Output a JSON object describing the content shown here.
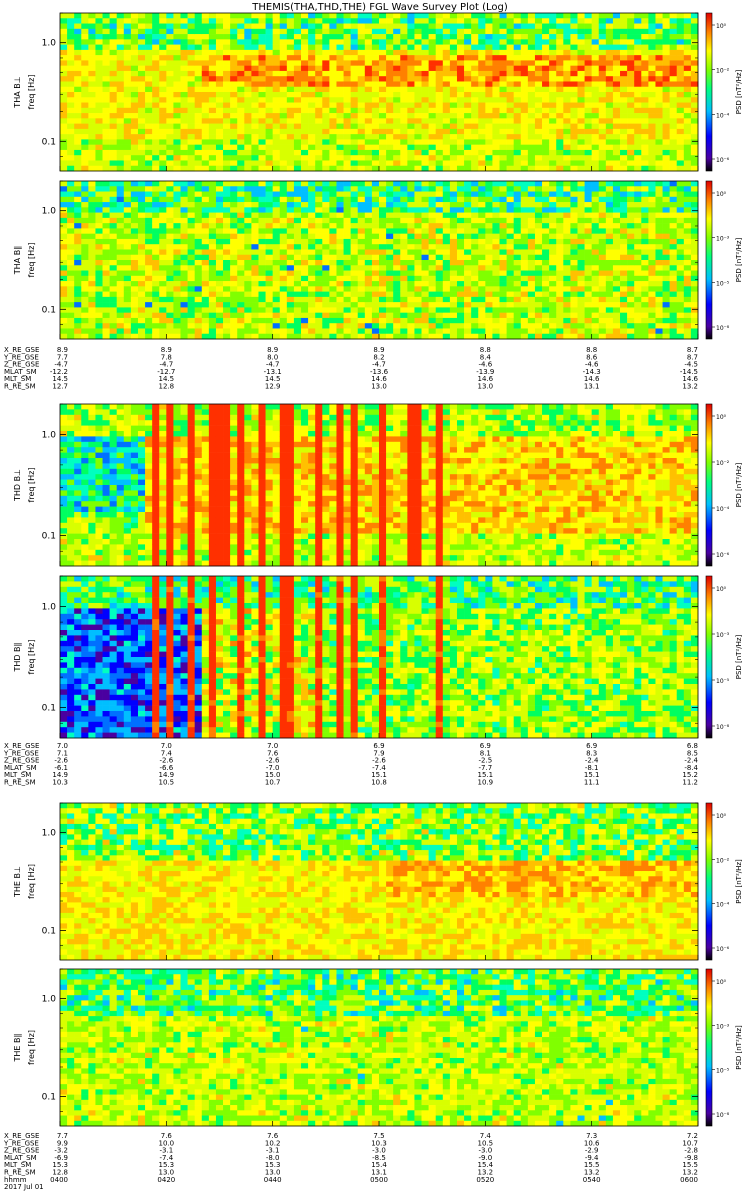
{
  "title": "THEMIS(THA,THD,THE) FGL Wave Survey Plot (Log)",
  "colorbar_label": "PSD [nT²/Hz]",
  "colorbar_ticks_top": [
    "10⁰",
    "10⁻²",
    "10⁻⁴",
    "10⁻⁶"
  ],
  "colorbar_ticks_bottom": [
    "10⁰",
    "10⁻³",
    "10⁻⁵",
    "10⁻⁸"
  ],
  "freq_ticks": [
    "1.0",
    "0.1"
  ],
  "chart_data": [
    {
      "type": "heatmap",
      "probe": "THA",
      "panels": [
        {
          "ylabel": "THA B⊥",
          "ylabel2": "freq [Hz]",
          "ylim": [
            0.05,
            2.0
          ],
          "scale": "log",
          "dominant_level": "yellow-orange, enhanced 0.2–0.4 Hz"
        },
        {
          "ylabel": "THA B∥",
          "ylabel2": "freq [Hz]",
          "ylim": [
            0.05,
            2.0
          ],
          "scale": "log",
          "dominant_level": "green-yellow"
        }
      ],
      "ephemeris": {
        "labels": [
          "X_RE_GSE",
          "Y_RE_GSE",
          "Z_RE_GSE",
          "MLAT_SM",
          "MLT_SM",
          "R_RE_SM"
        ],
        "columns": [
          [
            "8.9",
            "7.7",
            "-4.7",
            "-12.2",
            "14.5",
            "12.7"
          ],
          [
            "8.9",
            "7.8",
            "-4.7",
            "-12.7",
            "14.5",
            "12.8"
          ],
          [
            "8.9",
            "8.0",
            "-4.7",
            "-13.1",
            "14.5",
            "12.9"
          ],
          [
            "8.9",
            "8.2",
            "-4.7",
            "-13.6",
            "14.6",
            "13.0"
          ],
          [
            "8.8",
            "8.4",
            "-4.6",
            "-13.9",
            "14.6",
            "13.0"
          ],
          [
            "8.8",
            "8.6",
            "-4.6",
            "-14.3",
            "14.6",
            "13.1"
          ],
          [
            "8.7",
            "8.7",
            "-4.5",
            "-14.5",
            "14.6",
            "13.2"
          ]
        ]
      }
    },
    {
      "type": "heatmap",
      "probe": "THD",
      "panels": [
        {
          "ylabel": "THD B⊥",
          "ylabel2": "freq [Hz]",
          "ylim": [
            0.05,
            2.0
          ],
          "scale": "log",
          "dominant_level": "cyan early, red-orange bursts, yellow-orange later"
        },
        {
          "ylabel": "THD B∥",
          "ylabel2": "freq [Hz]",
          "ylim": [
            0.05,
            2.0
          ],
          "scale": "log",
          "dominant_level": "blue early, red bursts, green later"
        }
      ],
      "ephemeris": {
        "labels": [
          "X_RE_GSE",
          "Y_RE_GSE",
          "Z_RE_GSE",
          "MLAT_SM",
          "MLT_SM",
          "R_RE_SM"
        ],
        "columns": [
          [
            "7.0",
            "7.1",
            "-2.6",
            "-6.1",
            "14.9",
            "10.3"
          ],
          [
            "7.0",
            "7.4",
            "-2.6",
            "-6.6",
            "14.9",
            "10.5"
          ],
          [
            "7.0",
            "7.6",
            "-2.6",
            "-7.0",
            "15.0",
            "10.7"
          ],
          [
            "6.9",
            "7.9",
            "-2.6",
            "-7.4",
            "15.1",
            "10.8"
          ],
          [
            "6.9",
            "8.1",
            "-2.5",
            "-7.7",
            "15.1",
            "10.9"
          ],
          [
            "6.9",
            "8.3",
            "-2.4",
            "-8.1",
            "15.1",
            "11.1"
          ],
          [
            "6.8",
            "8.5",
            "-2.4",
            "-8.4",
            "15.2",
            "11.2"
          ]
        ]
      }
    },
    {
      "type": "heatmap",
      "probe": "THE",
      "panels": [
        {
          "ylabel": "THE B⊥",
          "ylabel2": "freq [Hz]",
          "ylim": [
            0.05,
            2.0
          ],
          "scale": "log",
          "dominant_level": "yellow-orange, green at high freq"
        },
        {
          "ylabel": "THE B∥",
          "ylabel2": "freq [Hz]",
          "ylim": [
            0.05,
            2.0
          ],
          "scale": "log",
          "dominant_level": "green-yellow"
        }
      ],
      "ephemeris": {
        "labels": [
          "X_RE_GSE",
          "Y_RE_GSE",
          "Z_RE_GSE",
          "MLAT_SM",
          "MLT_SM",
          "R_RE_SM",
          "hhmm",
          "2017 Jul 01"
        ],
        "columns": [
          [
            "7.7",
            "9.9",
            "-3.2",
            "-6.9",
            "15.3",
            "12.8",
            "0400"
          ],
          [
            "7.6",
            "10.0",
            "-3.1",
            "-7.4",
            "15.3",
            "13.0",
            "0420"
          ],
          [
            "7.6",
            "10.2",
            "-3.1",
            "-8.0",
            "15.3",
            "13.0",
            "0440"
          ],
          [
            "7.5",
            "10.3",
            "-3.0",
            "-8.5",
            "15.4",
            "13.1",
            "0500"
          ],
          [
            "7.4",
            "10.5",
            "-3.0",
            "-9.0",
            "15.4",
            "13.2",
            "0520"
          ],
          [
            "7.3",
            "10.6",
            "-2.9",
            "-9.4",
            "15.5",
            "13.2",
            "0540"
          ],
          [
            "7.2",
            "10.7",
            "-2.8",
            "-9.8",
            "15.5",
            "13.2",
            "0600"
          ]
        ]
      }
    }
  ]
}
